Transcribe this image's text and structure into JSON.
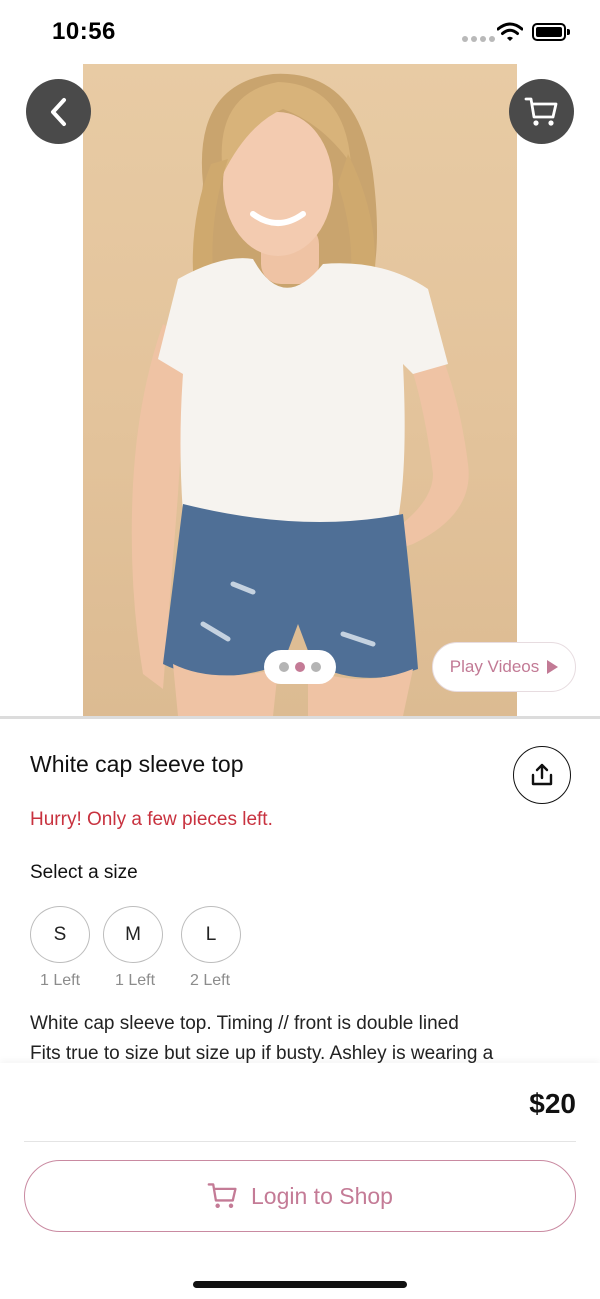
{
  "status_bar": {
    "time": "10:56",
    "icons": [
      "signal-dots-icon",
      "wifi-icon",
      "battery-icon"
    ]
  },
  "hero": {
    "image_subject": "Model wearing white cap sleeve top and denim shorts",
    "back_icon": "chevron-left-icon",
    "cart_icon": "cart-icon",
    "pager": {
      "count": 3,
      "active_index": 1
    },
    "play_videos_label": "Play Videos",
    "play_icon": "play-icon"
  },
  "product": {
    "title": "White cap sleeve top",
    "share_icon": "share-icon",
    "stock_warning": "Hurry! Only a few pieces left.",
    "size_heading": "Select a size",
    "sizes": [
      {
        "label": "S",
        "left": "1 Left"
      },
      {
        "label": "M",
        "left": "1 Left"
      },
      {
        "label": "L",
        "left": "2 Left"
      }
    ],
    "description_line1": "White cap sleeve top. Timing // front is double lined",
    "description_line2": "Fits true to size but size up if busty. Ashley is wearing a"
  },
  "bottom_bar": {
    "price": "$20",
    "login_label": "Login to Shop",
    "login_icon": "cart-icon"
  },
  "colors": {
    "accent_pink": "#c47b96",
    "warning_red": "#c8323f",
    "button_dark": "#4a4a4a"
  }
}
